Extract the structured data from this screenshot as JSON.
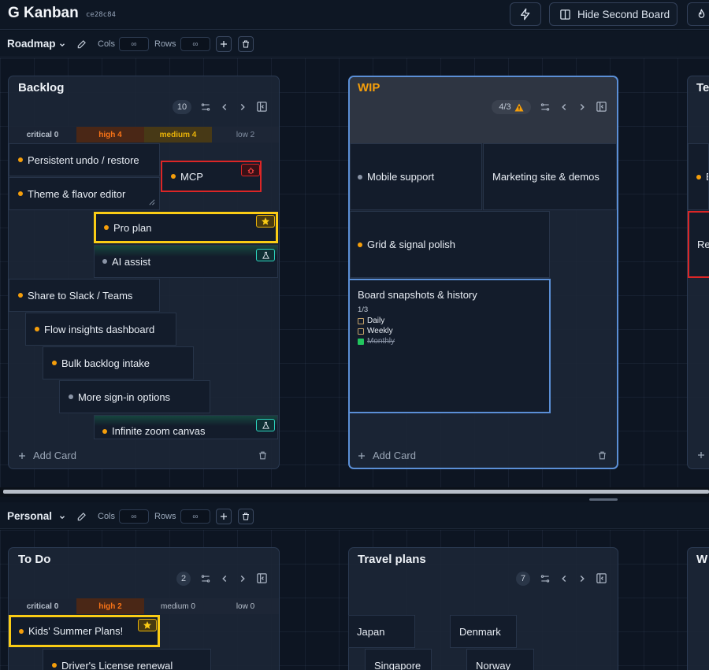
{
  "app": {
    "title": "G Kanban",
    "hash": "ce28c84",
    "buttons": {
      "hide_second_board": "Hide Second Board"
    }
  },
  "colors": {
    "accent_blue": "#60a5fa",
    "yellow": "#facc15",
    "red": "#dc2626",
    "orange_dot": "#f59e0b"
  },
  "boards": [
    {
      "name": "Roadmap",
      "cols_label": "Cols",
      "cols_value": "∞",
      "rows_label": "Rows",
      "rows_value": "∞",
      "columns": [
        {
          "title": "Backlog",
          "count": "10",
          "priorities": [
            {
              "label": "critical 0"
            },
            {
              "label": "high 4"
            },
            {
              "label": "medium 4"
            },
            {
              "label": "low 2"
            }
          ],
          "cards": [
            {
              "text": "Persistent undo / restore"
            },
            {
              "text": "MCP",
              "badge": "bug-icon"
            },
            {
              "text": "Theme & flavor editor"
            },
            {
              "text": "Pro plan",
              "badge": "star-icon"
            },
            {
              "text": "AI assist",
              "badge": "flask-icon"
            },
            {
              "text": "Share to Slack / Teams"
            },
            {
              "text": "Flow insights dashboard"
            },
            {
              "text": "Bulk backlog intake"
            },
            {
              "text": "More sign-in options"
            },
            {
              "text": "Infinite zoom canvas",
              "badge": "flask-icon"
            }
          ],
          "add_label": "Add Card"
        },
        {
          "title": "WIP",
          "count": "4/3",
          "cards": [
            {
              "text": "Mobile support"
            },
            {
              "text": "Marketing site & demos"
            },
            {
              "text": "Grid & signal polish"
            },
            {
              "text": "Board snapshots & history",
              "progress": "1/3",
              "checklist": [
                {
                  "text": "Daily",
                  "done": false
                },
                {
                  "text": "Weekly",
                  "done": false
                },
                {
                  "text": "Monthly",
                  "done": true
                }
              ]
            }
          ],
          "add_label": "Add Card"
        },
        {
          "title": "Te",
          "cards": [
            {
              "text": "B"
            },
            {
              "text": "Rel"
            }
          ]
        }
      ]
    },
    {
      "name": "Personal",
      "cols_label": "Cols",
      "cols_value": "∞",
      "rows_label": "Rows",
      "rows_value": "∞",
      "columns": [
        {
          "title": "To Do",
          "count": "2",
          "priorities": [
            {
              "label": "critical 0"
            },
            {
              "label": "high 2"
            },
            {
              "label": "medium 0"
            },
            {
              "label": "low 0"
            }
          ],
          "cards": [
            {
              "text": "Kids' Summer Plans!",
              "badge": "star-icon"
            },
            {
              "text": "Driver's License renewal"
            }
          ]
        },
        {
          "title": "Travel plans",
          "count": "7",
          "cards": [
            {
              "text": "Japan"
            },
            {
              "text": "Denmark"
            },
            {
              "text": "Singapore"
            },
            {
              "text": "Norway"
            }
          ]
        },
        {
          "title": "W"
        }
      ]
    }
  ]
}
